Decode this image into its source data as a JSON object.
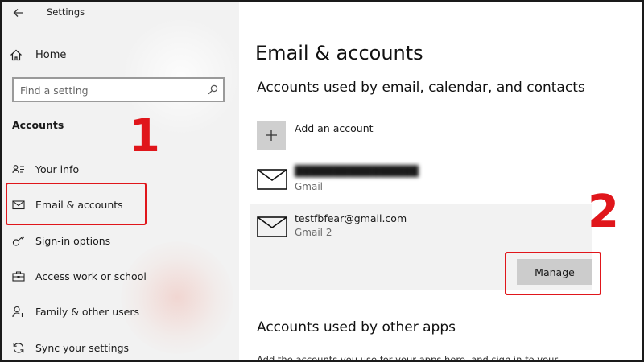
{
  "window": {
    "title": "Settings",
    "back_icon": "back-arrow-icon"
  },
  "sidebar": {
    "home_label": "Home",
    "search": {
      "placeholder": "Find a setting",
      "value": ""
    },
    "section_title": "Accounts",
    "items": [
      {
        "label": "Your info",
        "icon": "person-card-icon",
        "active": false
      },
      {
        "label": "Email & accounts",
        "icon": "envelope-icon",
        "active": true
      },
      {
        "label": "Sign-in options",
        "icon": "key-icon",
        "active": false
      },
      {
        "label": "Access work or school",
        "icon": "briefcase-icon",
        "active": false
      },
      {
        "label": "Family & other users",
        "icon": "person-add-icon",
        "active": false
      },
      {
        "label": "Sync your settings",
        "icon": "sync-icon",
        "active": false
      }
    ]
  },
  "main": {
    "title": "Email & accounts",
    "section1_title": "Accounts used by email, calendar, and contacts",
    "add_account_label": "Add an account",
    "accounts": [
      {
        "name": "████████████████",
        "provider": "Gmail",
        "redacted": true
      },
      {
        "name": "testfbfear@gmail.com",
        "provider": "Gmail 2",
        "redacted": false,
        "selected": true
      }
    ],
    "manage_label": "Manage",
    "section2_title": "Accounts used by other apps",
    "section2_desc": "Add the accounts you use for your apps here, and sign in to your"
  },
  "annotations": {
    "step1": "1",
    "step2": "2",
    "highlight_color": "#e0161b"
  },
  "colors": {
    "sidebar_bg": "#f2f2f2",
    "accent": "#2d8f99",
    "button_bg": "#cccccc",
    "selected_bg": "#f2f2f2"
  }
}
